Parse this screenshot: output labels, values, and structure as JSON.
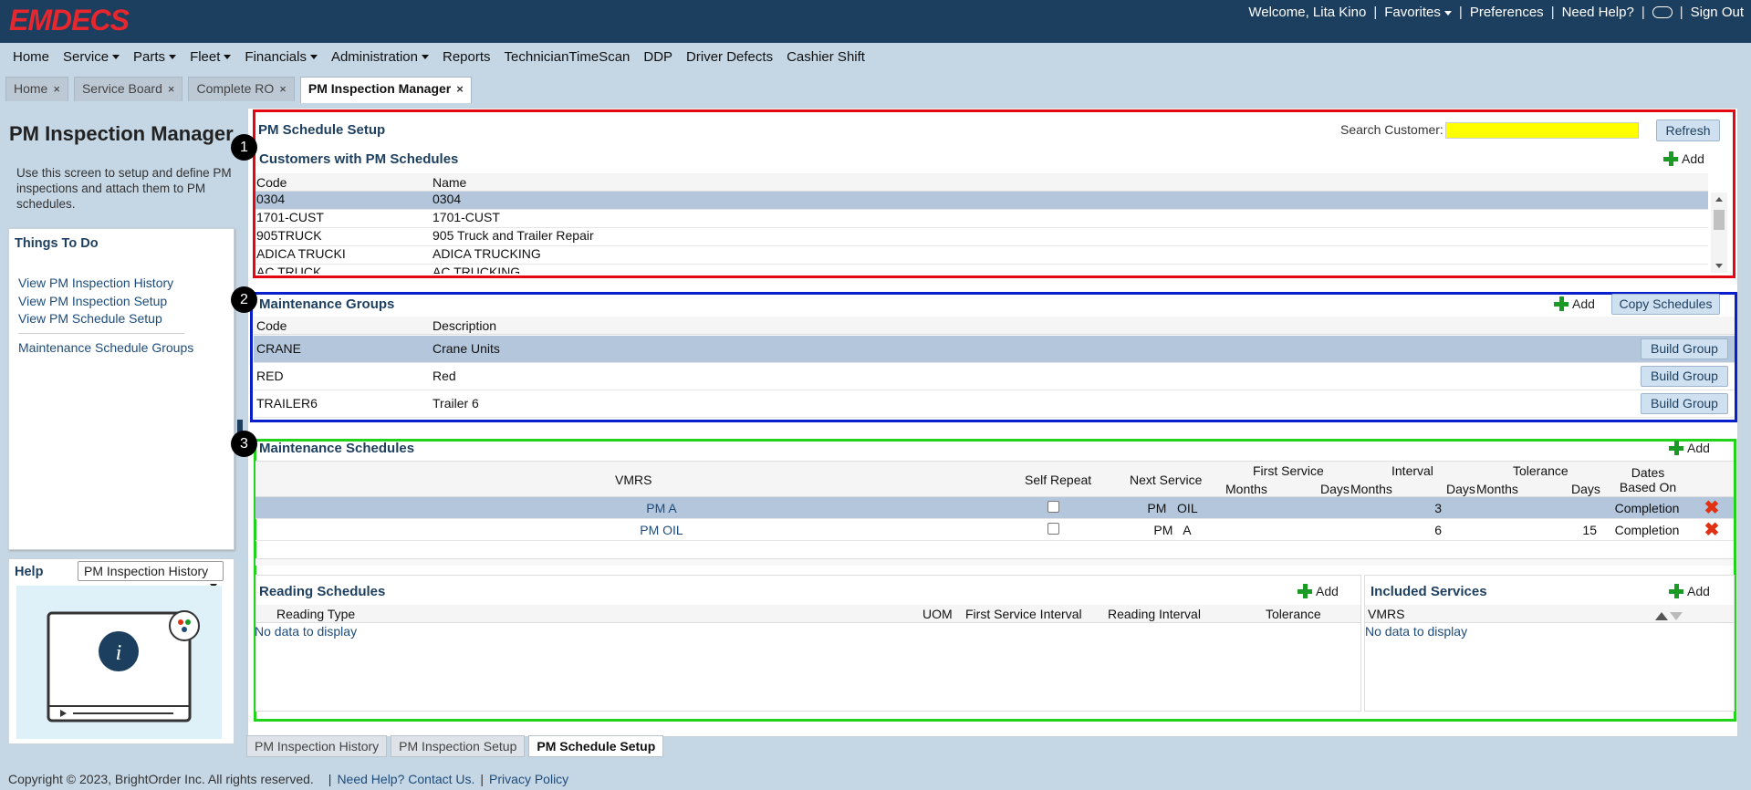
{
  "app": {
    "logo": "EMDECS"
  },
  "topbar": {
    "welcome": "Welcome, Lita Kino",
    "favorites": "Favorites",
    "preferences": "Preferences",
    "need_help": "Need Help?",
    "sign_out": "Sign Out"
  },
  "menu": [
    {
      "label": "Home",
      "dropdown": false
    },
    {
      "label": "Service",
      "dropdown": true
    },
    {
      "label": "Parts",
      "dropdown": true
    },
    {
      "label": "Fleet",
      "dropdown": true
    },
    {
      "label": "Financials",
      "dropdown": true
    },
    {
      "label": "Administration",
      "dropdown": true
    },
    {
      "label": "Reports",
      "dropdown": false
    },
    {
      "label": "TechnicianTimeScan",
      "dropdown": false
    },
    {
      "label": "DDP",
      "dropdown": false
    },
    {
      "label": "Driver Defects",
      "dropdown": false
    },
    {
      "label": "Cashier Shift",
      "dropdown": false
    }
  ],
  "tabs": [
    {
      "label": "Home",
      "active": false
    },
    {
      "label": "Service Board",
      "active": false
    },
    {
      "label": "Complete RO",
      "active": false
    },
    {
      "label": "PM Inspection Manager",
      "active": true
    }
  ],
  "close_glyph": "×",
  "left": {
    "title": "PM Inspection Manager",
    "description": "Use this screen to setup and define PM inspections and attach them to PM schedules.",
    "things_to_do": {
      "title": "Things To Do",
      "links": [
        "View PM Inspection History",
        "View PM Inspection Setup",
        "View PM Schedule Setup"
      ],
      "extra_link": "Maintenance Schedule Groups"
    },
    "help": {
      "label": "Help",
      "selected": "PM Inspection History"
    }
  },
  "badges": [
    "1",
    "2",
    "3"
  ],
  "schedule_setup": {
    "title": "PM Schedule Setup",
    "search_label": "Search Customer:",
    "search_value": "",
    "refresh": "Refresh",
    "highlight_color": "#ffff00"
  },
  "customers": {
    "title": "Customers with PM Schedules",
    "add": "Add",
    "headers": [
      "Code",
      "Name"
    ],
    "rows": [
      [
        "0304",
        "0304"
      ],
      [
        "1701-CUST",
        "1701-CUST"
      ],
      [
        "905TRUCK",
        "905 Truck and Trailer Repair"
      ],
      [
        "ADICA TRUCKI",
        "ADICA TRUCKING"
      ],
      [
        "AC TRUCK",
        "AC TRUCKING"
      ]
    ]
  },
  "groups": {
    "title": "Maintenance Groups",
    "add": "Add",
    "copy": "Copy Schedules",
    "headers": [
      "Code",
      "Description"
    ],
    "build_label": "Build Group",
    "rows": [
      [
        "CRANE",
        "Crane Units"
      ],
      [
        "RED",
        "Red"
      ],
      [
        "TRAILER6",
        "Trailer 6"
      ]
    ]
  },
  "schedules": {
    "title": "Maintenance Schedules",
    "add": "Add",
    "headers": {
      "vmrs": "VMRS",
      "self_repeat": "Self Repeat",
      "next_service": "Next Service",
      "first_service": "First Service",
      "interval": "Interval",
      "tolerance": "Tolerance",
      "dates_based": "Dates Based On",
      "months": "Months",
      "days": "Days"
    },
    "rows": [
      {
        "vmrs": "PM A",
        "next": "PM   OIL",
        "fs_m": "",
        "fs_d": "",
        "int_m": "3",
        "int_d": "",
        "tol_m": "",
        "tol_d": "",
        "based": "Completion"
      },
      {
        "vmrs": "PM OIL",
        "next": "PM   A",
        "fs_m": "",
        "fs_d": "",
        "int_m": "6",
        "int_d": "",
        "tol_m": "",
        "tol_d": "15",
        "based": "Completion"
      }
    ],
    "delete_glyph": "✖"
  },
  "reading": {
    "title": "Reading Schedules",
    "add": "Add",
    "headers": [
      "Reading Type",
      "UOM",
      "First Service Interval",
      "Reading Interval",
      "Tolerance"
    ],
    "empty": "No data to display"
  },
  "included": {
    "title": "Included Services",
    "add": "Add",
    "header": "VMRS",
    "empty": "No data to display"
  },
  "bottom_tabs": [
    {
      "label": "PM Inspection History",
      "active": false
    },
    {
      "label": "PM Inspection Setup",
      "active": false
    },
    {
      "label": "PM Schedule Setup",
      "active": true
    }
  ],
  "footer": {
    "copyright": "Copyright © 2023, BrightOrder Inc. All rights reserved.",
    "help": "Need Help? Contact Us.",
    "privacy": "Privacy Policy",
    "sep": "|"
  },
  "colors": {
    "topbar": "#1d3f5f",
    "logo": "#e8262d",
    "box1": "#e30613",
    "box2": "#0a1fcc",
    "box3": "#22d31c"
  }
}
